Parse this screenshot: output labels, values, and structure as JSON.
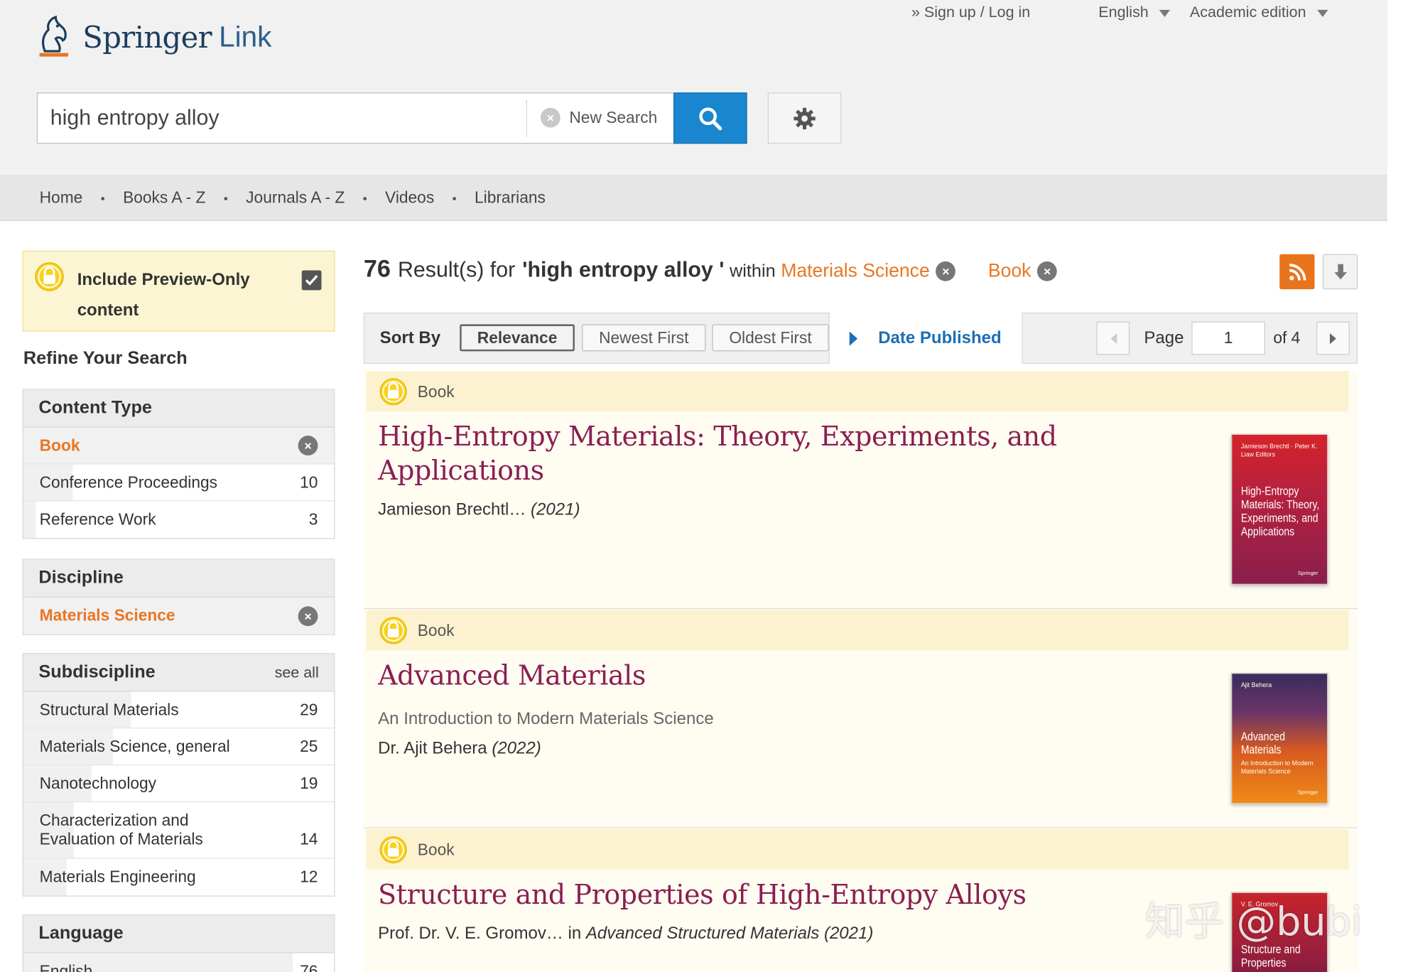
{
  "header": {
    "brand": "Springer",
    "brand_link": "Link",
    "sign_in": "» Sign up / Log in",
    "language": "English",
    "edition": "Academic edition",
    "search_value": "high entropy alloy",
    "new_search": "New Search"
  },
  "nav": [
    "Home",
    "Books A - Z",
    "Journals A - Z",
    "Videos",
    "Librarians"
  ],
  "sidebar": {
    "preview_label": "Include Preview-Only content",
    "preview_checked": true,
    "refine_title": "Refine Your Search",
    "content_type": {
      "title": "Content Type",
      "selected": "Book",
      "items": [
        {
          "label": "Conference Proceedings",
          "count": "10"
        },
        {
          "label": "Reference Work",
          "count": "3"
        }
      ]
    },
    "discipline": {
      "title": "Discipline",
      "selected": "Materials Science"
    },
    "subdiscipline": {
      "title": "Subdiscipline",
      "see_all": "see all",
      "items": [
        {
          "label": "Structural Materials",
          "count": "29"
        },
        {
          "label": "Materials Science, general",
          "count": "25"
        },
        {
          "label": "Nanotechnology",
          "count": "19"
        },
        {
          "label": "Characterization and Evaluation of Materials",
          "count": "14"
        },
        {
          "label": "Materials Engineering",
          "count": "12"
        }
      ]
    },
    "language": {
      "title": "Language",
      "items": [
        {
          "label": "English",
          "count": "76"
        }
      ]
    }
  },
  "results_header": {
    "count": "76",
    "result_text": "Result(s) for",
    "query": "'high entropy alloy '",
    "within": "within",
    "filter1": "Materials Science",
    "filter2": "Book"
  },
  "sort": {
    "label": "Sort By",
    "options": [
      "Relevance",
      "Newest First",
      "Oldest First"
    ],
    "active": "Relevance",
    "date_published": "Date Published",
    "page_label": "Page",
    "page_value": "1",
    "page_of": "of 4"
  },
  "results": [
    {
      "type": "Book",
      "title": "High-Entropy Materials: Theory, Experiments, and Applications",
      "subtitle": "",
      "authors": "Jamieson Brechtl…",
      "year": "(2021)",
      "cover_top": "Jamieson Brechtl · Peter K. Liaw  Editors",
      "cover_title": "High-Entropy Materials: Theory, Experiments, and Applications",
      "cover_pub": "Springer"
    },
    {
      "type": "Book",
      "title": "Advanced Materials",
      "subtitle": "An Introduction to Modern Materials Science",
      "authors": "Dr. Ajit Behera",
      "year": "(2022)",
      "cover_top": "Ajit Behera",
      "cover_title": "Advanced Materials",
      "cover_sub": "An Introduction to Modern Materials Science",
      "cover_pub": "Springer"
    },
    {
      "type": "Book",
      "title": "Structure and Properties of High-Entropy Alloys",
      "subtitle": "",
      "authors": "Prof. Dr. V. E. Gromov…",
      "in_text": "in",
      "series": "Advanced Structured Materials",
      "year": "(2021)",
      "cover_top": "V. E. Gromov",
      "cover_title": "Structure and Properties"
    }
  ],
  "watermark": "知乎 @bubi",
  "colors": {
    "accent_orange": "#e87723",
    "link_blue": "#1a6fb5",
    "title_maroon": "#8a1f52",
    "search_blue": "#1a86d0"
  }
}
